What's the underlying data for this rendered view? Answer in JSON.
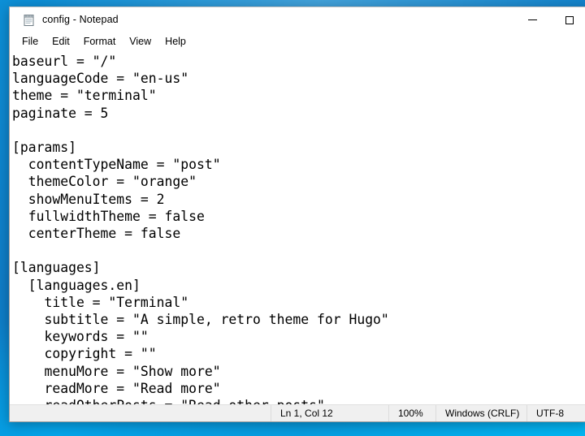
{
  "window": {
    "title": "config - Notepad",
    "icon": "notepad-icon",
    "controls": {
      "minimize_label": "—",
      "maximize_label": "□"
    }
  },
  "menu": {
    "items": [
      {
        "label": "File"
      },
      {
        "label": "Edit"
      },
      {
        "label": "Format"
      },
      {
        "label": "View"
      },
      {
        "label": "Help"
      }
    ]
  },
  "editor": {
    "content": "baseurl = \"/\"\nlanguageCode = \"en-us\"\ntheme = \"terminal\"\npaginate = 5\n\n[params]\n  contentTypeName = \"post\"\n  themeColor = \"orange\"\n  showMenuItems = 2\n  fullwidthTheme = false\n  centerTheme = false\n\n[languages]\n  [languages.en]\n    title = \"Terminal\"\n    subtitle = \"A simple, retro theme for Hugo\"\n    keywords = \"\"\n    copyright = \"\"\n    menuMore = \"Show more\"\n    readMore = \"Read more\"\n    readOtherPosts = \"Read other posts\"",
    "lines": [
      "baseurl = \"/\"",
      "languageCode = \"en-us\"",
      "theme = \"terminal\"",
      "paginate = 5",
      "",
      "[params]",
      "  contentTypeName = \"post\"",
      "  themeColor = \"orange\"",
      "  showMenuItems = 2",
      "  fullwidthTheme = false",
      "  centerTheme = false",
      "",
      "[languages]",
      "  [languages.en]",
      "    title = \"Terminal\"",
      "    subtitle = \"A simple, retro theme for Hugo\"",
      "    keywords = \"\"",
      "    copyright = \"\"",
      "    menuMore = \"Show more\"",
      "    readMore = \"Read more\"",
      "    readOtherPosts = \"Read other posts\""
    ]
  },
  "statusbar": {
    "cursor": "Ln 1, Col 12",
    "zoom": "100%",
    "line_ending": "Windows (CRLF)",
    "encoding": "UTF-8"
  },
  "colors": {
    "desktop_blue": "#0d8fd6",
    "desktop_blue_light": "#03b6f2",
    "window_bg": "#ffffff",
    "statusbar_bg": "#f0f0f0",
    "text": "#000000"
  }
}
